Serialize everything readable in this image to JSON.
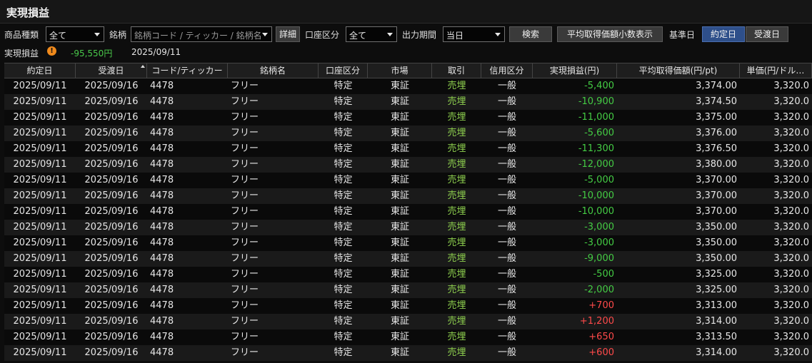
{
  "window": {
    "title": "実現損益"
  },
  "filters": {
    "product_type_label": "商品種類",
    "product_type_value": "全て",
    "symbol_label": "銘柄",
    "symbol_placeholder": "銘柄コード / ティッカー / 銘柄名",
    "detail_button": "詳細",
    "account_label": "口座区分",
    "account_value": "全て",
    "period_label": "出力期間",
    "period_value": "当日",
    "search_button": "検索",
    "decimal_button": "平均取得価額小数表示",
    "base_date_label": "基準日",
    "contract_date_button": "約定日",
    "delivery_date_button": "受渡日"
  },
  "summary": {
    "label": "実現損益",
    "value": "-95,550円",
    "date": "2025/09/11"
  },
  "table": {
    "headers": [
      "約定日",
      "受渡日",
      "コード/ティッカー",
      "銘柄名",
      "口座区分",
      "市場",
      "取引",
      "信用区分",
      "実現損益(円)",
      "平均取得価額(円/pt)",
      "単価(円/ドル…"
    ],
    "rows": [
      {
        "trade_date": "2025/09/11",
        "settle_date": "2025/09/16",
        "code": "4478",
        "name": "フリー",
        "account": "特定",
        "market": "東証",
        "trade": "売埋",
        "credit": "一般",
        "pnl": "-5,400",
        "avg_price": "3,374.00",
        "unit_price": "3,320.0"
      },
      {
        "trade_date": "2025/09/11",
        "settle_date": "2025/09/16",
        "code": "4478",
        "name": "フリー",
        "account": "特定",
        "market": "東証",
        "trade": "売埋",
        "credit": "一般",
        "pnl": "-10,900",
        "avg_price": "3,374.50",
        "unit_price": "3,320.0"
      },
      {
        "trade_date": "2025/09/11",
        "settle_date": "2025/09/16",
        "code": "4478",
        "name": "フリー",
        "account": "特定",
        "market": "東証",
        "trade": "売埋",
        "credit": "一般",
        "pnl": "-11,000",
        "avg_price": "3,375.00",
        "unit_price": "3,320.0"
      },
      {
        "trade_date": "2025/09/11",
        "settle_date": "2025/09/16",
        "code": "4478",
        "name": "フリー",
        "account": "特定",
        "market": "東証",
        "trade": "売埋",
        "credit": "一般",
        "pnl": "-5,600",
        "avg_price": "3,376.00",
        "unit_price": "3,320.0"
      },
      {
        "trade_date": "2025/09/11",
        "settle_date": "2025/09/16",
        "code": "4478",
        "name": "フリー",
        "account": "特定",
        "market": "東証",
        "trade": "売埋",
        "credit": "一般",
        "pnl": "-11,300",
        "avg_price": "3,376.50",
        "unit_price": "3,320.0"
      },
      {
        "trade_date": "2025/09/11",
        "settle_date": "2025/09/16",
        "code": "4478",
        "name": "フリー",
        "account": "特定",
        "market": "東証",
        "trade": "売埋",
        "credit": "一般",
        "pnl": "-12,000",
        "avg_price": "3,380.00",
        "unit_price": "3,320.0"
      },
      {
        "trade_date": "2025/09/11",
        "settle_date": "2025/09/16",
        "code": "4478",
        "name": "フリー",
        "account": "特定",
        "market": "東証",
        "trade": "売埋",
        "credit": "一般",
        "pnl": "-5,000",
        "avg_price": "3,370.00",
        "unit_price": "3,320.0"
      },
      {
        "trade_date": "2025/09/11",
        "settle_date": "2025/09/16",
        "code": "4478",
        "name": "フリー",
        "account": "特定",
        "market": "東証",
        "trade": "売埋",
        "credit": "一般",
        "pnl": "-10,000",
        "avg_price": "3,370.00",
        "unit_price": "3,320.0"
      },
      {
        "trade_date": "2025/09/11",
        "settle_date": "2025/09/16",
        "code": "4478",
        "name": "フリー",
        "account": "特定",
        "market": "東証",
        "trade": "売埋",
        "credit": "一般",
        "pnl": "-10,000",
        "avg_price": "3,370.00",
        "unit_price": "3,320.0"
      },
      {
        "trade_date": "2025/09/11",
        "settle_date": "2025/09/16",
        "code": "4478",
        "name": "フリー",
        "account": "特定",
        "market": "東証",
        "trade": "売埋",
        "credit": "一般",
        "pnl": "-3,000",
        "avg_price": "3,350.00",
        "unit_price": "3,320.0"
      },
      {
        "trade_date": "2025/09/11",
        "settle_date": "2025/09/16",
        "code": "4478",
        "name": "フリー",
        "account": "特定",
        "market": "東証",
        "trade": "売埋",
        "credit": "一般",
        "pnl": "-3,000",
        "avg_price": "3,350.00",
        "unit_price": "3,320.0"
      },
      {
        "trade_date": "2025/09/11",
        "settle_date": "2025/09/16",
        "code": "4478",
        "name": "フリー",
        "account": "特定",
        "market": "東証",
        "trade": "売埋",
        "credit": "一般",
        "pnl": "-9,000",
        "avg_price": "3,350.00",
        "unit_price": "3,320.0"
      },
      {
        "trade_date": "2025/09/11",
        "settle_date": "2025/09/16",
        "code": "4478",
        "name": "フリー",
        "account": "特定",
        "market": "東証",
        "trade": "売埋",
        "credit": "一般",
        "pnl": "-500",
        "avg_price": "3,325.00",
        "unit_price": "3,320.0"
      },
      {
        "trade_date": "2025/09/11",
        "settle_date": "2025/09/16",
        "code": "4478",
        "name": "フリー",
        "account": "特定",
        "market": "東証",
        "trade": "売埋",
        "credit": "一般",
        "pnl": "-2,000",
        "avg_price": "3,325.00",
        "unit_price": "3,320.0"
      },
      {
        "trade_date": "2025/09/11",
        "settle_date": "2025/09/16",
        "code": "4478",
        "name": "フリー",
        "account": "特定",
        "market": "東証",
        "trade": "売埋",
        "credit": "一般",
        "pnl": "+700",
        "avg_price": "3,313.00",
        "unit_price": "3,320.0"
      },
      {
        "trade_date": "2025/09/11",
        "settle_date": "2025/09/16",
        "code": "4478",
        "name": "フリー",
        "account": "特定",
        "market": "東証",
        "trade": "売埋",
        "credit": "一般",
        "pnl": "+1,200",
        "avg_price": "3,314.00",
        "unit_price": "3,320.0"
      },
      {
        "trade_date": "2025/09/11",
        "settle_date": "2025/09/16",
        "code": "4478",
        "name": "フリー",
        "account": "特定",
        "market": "東証",
        "trade": "売埋",
        "credit": "一般",
        "pnl": "+650",
        "avg_price": "3,313.50",
        "unit_price": "3,320.0"
      },
      {
        "trade_date": "2025/09/11",
        "settle_date": "2025/09/16",
        "code": "4478",
        "name": "フリー",
        "account": "特定",
        "market": "東証",
        "trade": "売埋",
        "credit": "一般",
        "pnl": "+600",
        "avg_price": "3,314.00",
        "unit_price": "3,320.0"
      }
    ]
  },
  "colors": {
    "loss": "#44cc44",
    "gain": "#ff4a4a",
    "sell_text": "#8fd14f",
    "active_button": "#2e4f8a",
    "warning_icon": "#f08a1c"
  }
}
